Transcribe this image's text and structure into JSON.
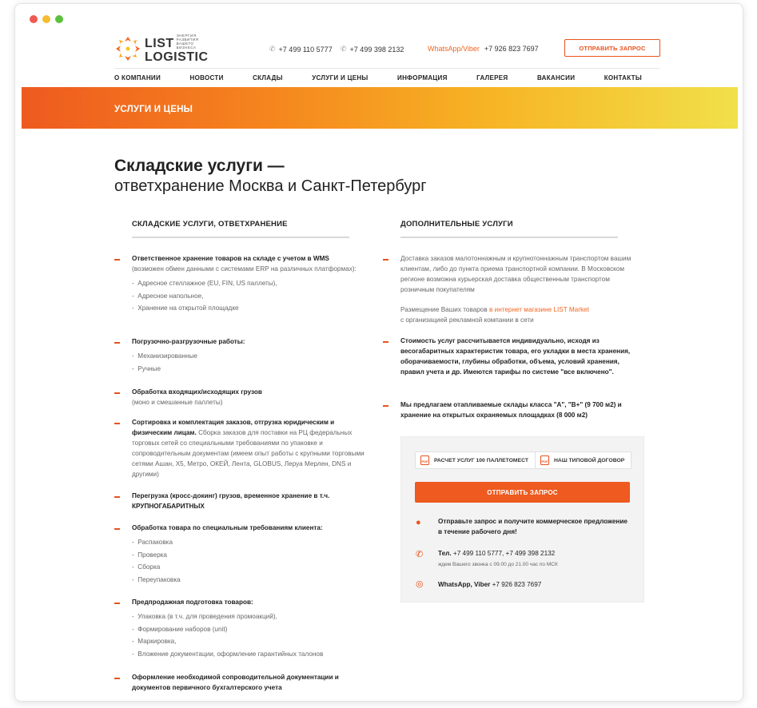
{
  "header": {
    "logo_line1": "LIST",
    "logo_tagline": "энергия развития вашего бизнеса",
    "logo_line2": "LOGISTIC",
    "phone1": "+7 499 110 5777",
    "phone2": "+7 499 398 2132",
    "whatsapp_label": "WhatsApp/Viber",
    "whatsapp_number": "+7 926 823 7697",
    "request_button": "Отправить запрос"
  },
  "nav": [
    "О компании",
    "Новости",
    "Склады",
    "Услуги и цены",
    "Информация",
    "Галерея",
    "Вакансии",
    "Контакты"
  ],
  "banner": {
    "title": "Услуги и цены"
  },
  "page": {
    "title_bold": "Складские услуги —",
    "title_rest": "ответхранение Москва и Санкт-Петербург"
  },
  "left": {
    "heading": "Складские услуги, ответхранение",
    "items": [
      {
        "bold": "Ответственное хранение товаров на складе с учетом в WMS",
        "normal": "(возможен обмен данными с системами ERP на различных платформах):",
        "subs": [
          "Адресное стеллажное (EU, FIN, US паллеты),",
          "Адресное напольное,",
          "Хранение на открытой площадке"
        ]
      },
      {
        "bold": "Погрузочно-разгрузочные работы:",
        "normal": "",
        "subs": [
          "Механизированные",
          "Ручные"
        ]
      },
      {
        "bold": "Обработка входящих/исходящих грузов",
        "normal": "(моно и смешанные паллеты)",
        "subs": []
      },
      {
        "bold": "Сортировка и комплектация заказов, отгрузка юридическим и физическим лицам.",
        "normal": "Сборка заказов для поставки на РЦ федеральных торговых сетей со специальными требованиями по упаковке и сопроводительным документам (имеем опыт работы с крупными торговыми сетями Ашан, X5, Метро, ОКЕЙ, Лента, GLOBUS, Леруа Мерлен, DNS и другими)",
        "subs": []
      },
      {
        "bold": "Перегрузка (кросс-докинг) грузов, временное хранение в т.ч. КРУПНОГАБАРИТНЫХ",
        "normal": "",
        "subs": []
      },
      {
        "bold": "Обработка товара по специальным требованиям клиента:",
        "normal": "",
        "subs": [
          "Распаковка",
          "Проверка",
          "Сборка",
          "Переупаковка"
        ]
      },
      {
        "bold": "Предпродажная подготовка товаров:",
        "normal": "",
        "subs": [
          "Упаковка (в т.ч. для проведения промоакций),",
          "Формирование наборов (unit)",
          "Маркировка,",
          "Вложение документации, оформление гарантийных талонов"
        ]
      },
      {
        "bold": "Оформление необходимой сопроводительной документации и документов первичного бухгалтерского учета",
        "normal": "",
        "subs": []
      }
    ]
  },
  "right": {
    "heading": "Дополнительные услуги",
    "p1": "Доставка заказов малотоннажным и крупнотоннажным транспортом вашим клиентам, либо до пункта приема транспортной компании. В Московском регионе возможна курьерская доставка общественным транспортом розничным покупателям",
    "p2_before": "Размещение Ваших товаров ",
    "p2_link": "в интернет магазине LIST Market",
    "p2_after": "с организацией рекламной компании в сети",
    "b1": "Стоимость услуг рассчитывается индивидуально, исходя из весогабаритных характеристик товара, его укладки в места хранения, оборачиваемости, глубины обработки, объема, условий хранения, правил учета и др. Имеются тарифы по системе \"все включено\".",
    "b2": "Мы предлагаем отапливаемые склады класса \"А\", \"В+\" (9 700 м2) и хранение на открытых охраняемых площадках (8 000 м2)"
  },
  "panel": {
    "chip1": "Расчет услуг 100 паллетомест",
    "chip2": "Наш типовой договор",
    "pdf_label": "PDF",
    "send_button": "Отправить запрос",
    "offer": "Отправьте запрос и получите коммерческое предложение в течение рабочего дня!",
    "tel_label": "Тел.",
    "tel_numbers": "+7 499 110 5777, +7 499 398 2132",
    "tel_hours": "ждем Вашего звонка с 09.00 до 21.00 час по МСК",
    "wa_label": "WhatsApp, Viber",
    "wa_number": "+7 926 823 7697"
  },
  "colors": {
    "accent": "#e8521d",
    "banner_start": "#ee5a1f",
    "banner_end": "#f1e04a"
  }
}
